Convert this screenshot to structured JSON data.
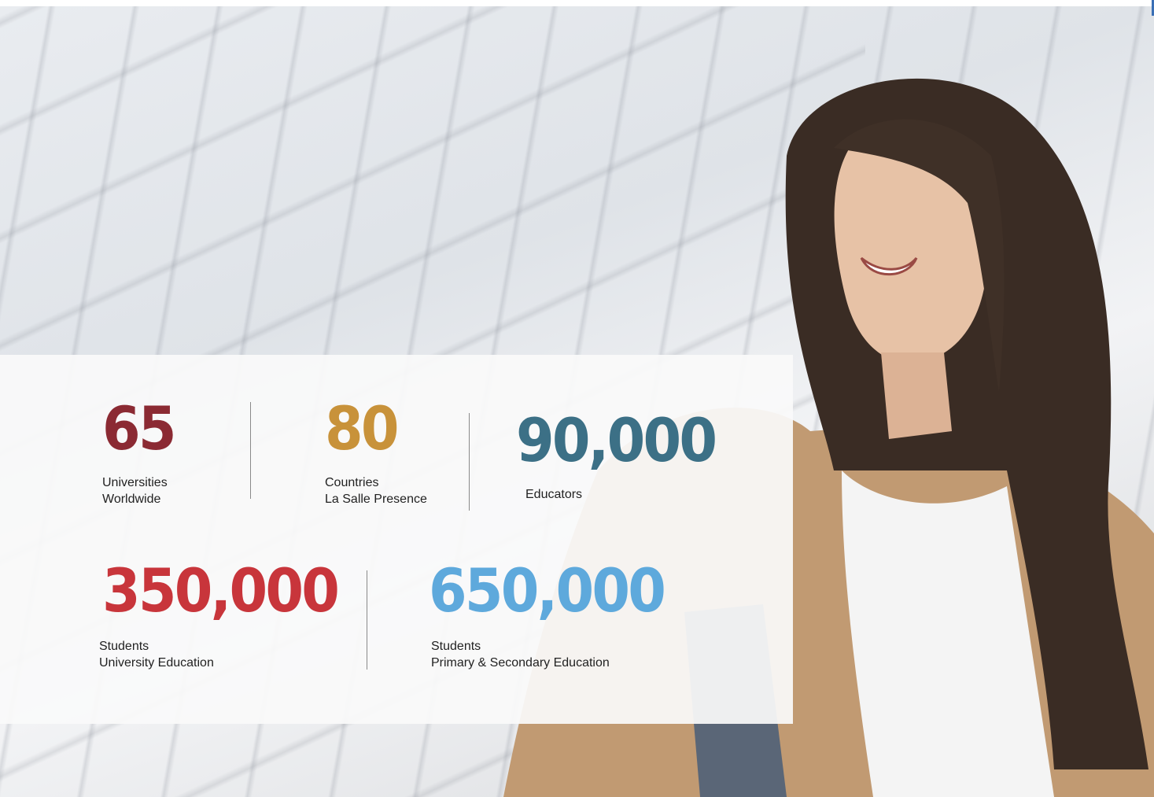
{
  "colors": {
    "universities": "#8b2a33",
    "countries": "#c8923a",
    "educators": "#3c7086",
    "university_students": "#c8353b",
    "school_students": "#5ea9dc"
  },
  "stats": [
    {
      "value": "65",
      "label_line1": "Universities",
      "label_line2": "Worldwide"
    },
    {
      "value": "80",
      "label_line1": "Countries",
      "label_line2": "La Salle Presence"
    },
    {
      "value": "90,000",
      "label_line1": "Educators",
      "label_line2": ""
    },
    {
      "value": "350,000",
      "label_line1": "Students",
      "label_line2": "University Education"
    },
    {
      "value": "650,000",
      "label_line1": "Students",
      "label_line2": "Primary & Secondary Education"
    }
  ]
}
